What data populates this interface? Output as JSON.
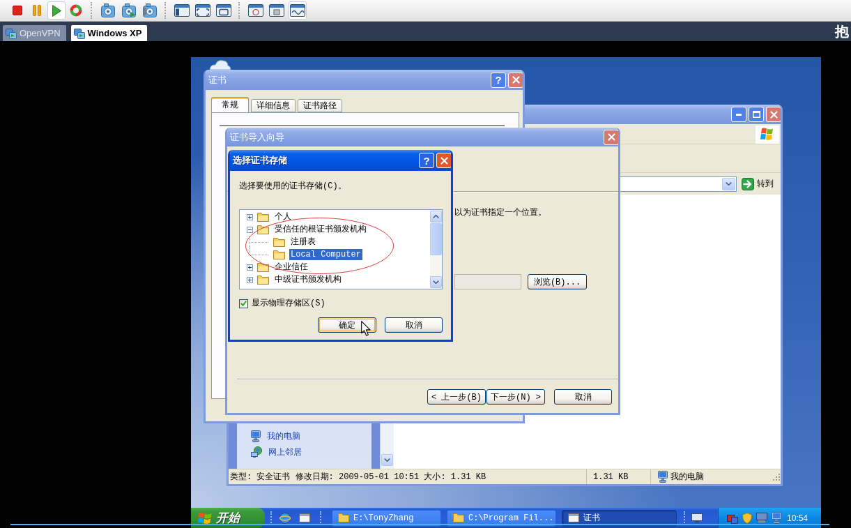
{
  "vm_toolbar": {
    "groups": [
      {
        "buttons": [
          {
            "pressed": false
          },
          {
            "pressed": false
          },
          {
            "pressed": true
          },
          {
            "pressed": false
          }
        ]
      },
      {
        "buttons": [
          {
            "pressed": false
          },
          {
            "pressed": false
          },
          {
            "pressed": false
          }
        ]
      },
      {
        "buttons": [
          {
            "pressed": false
          },
          {
            "pressed": false
          },
          {
            "pressed": false
          }
        ]
      },
      {
        "buttons": [
          {
            "pressed": false
          },
          {
            "pressed": false
          },
          {
            "pressed": true
          }
        ]
      }
    ]
  },
  "vm_tabs": [
    {
      "label": "OpenVPN",
      "selected": false
    },
    {
      "label": "Windows XP",
      "selected": true
    }
  ],
  "corner_text": "抱",
  "certificate_window": {
    "title": "证书",
    "help_button": "?",
    "tabs": [
      {
        "label": "常规",
        "selected": true
      },
      {
        "label": "详细信息",
        "selected": false
      },
      {
        "label": "证书路径",
        "selected": false
      }
    ]
  },
  "explorer_window": {
    "go_button": "转到",
    "sidebar_links": [
      "我的电脑",
      "网上邻居"
    ],
    "status_bar": [
      "类型: 安全证书 修改日期: 2009-05-01 10:51 大小: 1.31 KB",
      "1.31 KB",
      "我的电脑"
    ]
  },
  "import_wizard": {
    "title": "证书导入向导",
    "instruction": "以为证书指定一个位置。",
    "path_field": {
      "disabled": true
    },
    "browse_button": "浏览(B)...",
    "buttons": [
      "< 上一步(B)",
      "下一步(N) >",
      "取消"
    ]
  },
  "store_dialog": {
    "title": "选择证书存储",
    "help_button": "?",
    "prompt": "选择要使用的证书存储(C)。",
    "tree": [
      {
        "label": "个人",
        "expanded": false,
        "selected": false
      },
      {
        "label": "受信任的根证书颁发机构",
        "expanded": true,
        "selected": false,
        "children": [
          {
            "label": "注册表",
            "selected": false
          },
          {
            "label": "Local Computer",
            "selected": true
          }
        ]
      },
      {
        "label": "企业信任",
        "expanded": false,
        "selected": false
      },
      {
        "label": "中级证书颁发机构",
        "expanded": false,
        "selected": false
      }
    ],
    "show_physical_stores": {
      "label": "显示物理存储区(S)",
      "checked": true
    },
    "buttons": [
      {
        "label": "确定",
        "default": true
      },
      {
        "label": "取消",
        "default": false
      }
    ]
  },
  "taskbar": {
    "start_button": "开始",
    "tasks": [
      {
        "label": "E:\\TonyZhang",
        "selected": false
      },
      {
        "label": "C:\\Program Fil...",
        "selected": false
      },
      {
        "label": "证书",
        "selected": true
      }
    ],
    "clock": "10:54"
  }
}
